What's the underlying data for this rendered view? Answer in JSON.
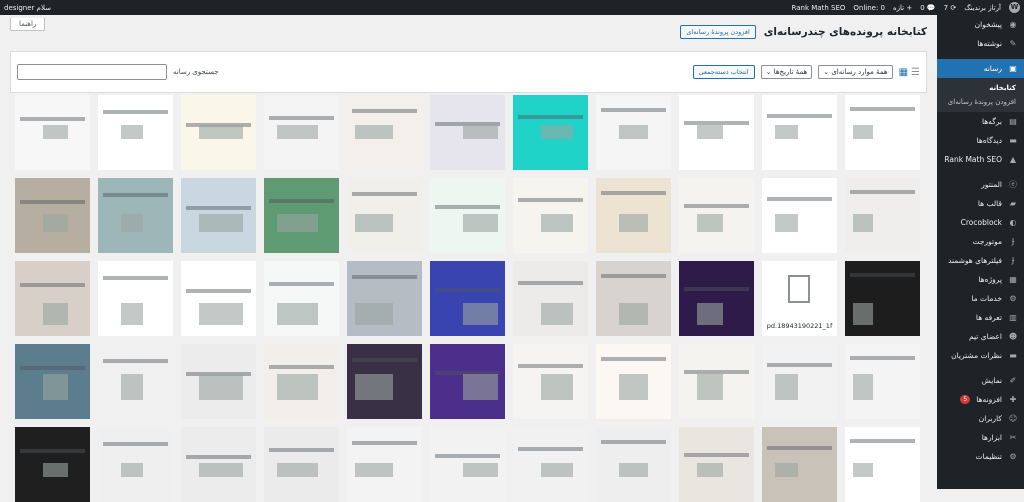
{
  "admin_bar": {
    "user_greeting": "سلام designer",
    "site_name": "آرتاز برندینگ",
    "updates_count": "7",
    "comments_count": "0",
    "new_label": "تازه",
    "rank_math_label": "Rank Math SEO",
    "online_label": "Online: 0"
  },
  "help_tab_label": "راهنما",
  "page": {
    "title": "کتابخانه پرونده‌های چندرسانه‌ای",
    "add_new_label": "افزودن پروندهٔ رسانه‌ای"
  },
  "toolbar": {
    "media_type_filter": "همهٔ موارد رسانه‌ای",
    "date_filter": "همهٔ تاریخ‌ها",
    "bulk_select_label": "انتخاب دسته‌جمعی",
    "search_label": "جستجوی رسانه",
    "search_value": ""
  },
  "sidebar": {
    "items": [
      {
        "label": "پیشخوان",
        "icon": "dashboard-icon"
      },
      {
        "label": "نوشته‌ها",
        "icon": "pin-icon"
      },
      {
        "label": "رسانه",
        "icon": "media-icon",
        "active": true
      },
      {
        "label": "برگه‌ها",
        "icon": "page-icon"
      },
      {
        "label": "دیدگاه‌ها",
        "icon": "comment-icon"
      },
      {
        "label": "Rank Math SEO",
        "icon": "rankmath-icon"
      },
      {
        "label": "المنتور",
        "icon": "elementor-icon"
      },
      {
        "label": "قالب ها",
        "icon": "folder-icon"
      },
      {
        "label": "Crocoblock",
        "icon": "crocoblock-icon"
      },
      {
        "label": "موتورجت",
        "icon": "jet-icon"
      },
      {
        "label": "فیلترهای هوشمند",
        "icon": "jet-icon"
      },
      {
        "label": "پروژه‌ها",
        "icon": "grid-icon"
      },
      {
        "label": "خدمات ما",
        "icon": "gear-icon"
      },
      {
        "label": "تعرفه ها",
        "icon": "price-icon"
      },
      {
        "label": "اعضای تیم",
        "icon": "team-icon"
      },
      {
        "label": "نظرات مشتریان",
        "icon": "comment-icon"
      },
      {
        "label": "نمایش",
        "icon": "brush-icon"
      },
      {
        "label": "افزونه‌ها",
        "icon": "plugin-icon",
        "badge": "5"
      },
      {
        "label": "کاربران",
        "icon": "user-icon"
      },
      {
        "label": "ابزارها",
        "icon": "wrench-icon"
      },
      {
        "label": "تنظیمات",
        "icon": "settings-icon"
      }
    ],
    "submenu": [
      "کتابخانه",
      "افزودن پروندهٔ رسانه‌ای"
    ]
  },
  "media": {
    "pdf_filename": "pd.18943190221_1f",
    "colors": {
      "row1": [
        "#ffffff",
        "#ffffff",
        "#ffffff",
        "#f5f5f5",
        "#20d3c8",
        "#e6e4ec",
        "#f3f0ec",
        "#f4f4f4",
        "#fbf6ea",
        "#ffffff",
        "#f7f7f7"
      ],
      "row2": [
        "#efeeec",
        "#ffffff",
        "#f4f3f0",
        "#ece3d3",
        "#f6f4ef",
        "#eef6f2",
        "#f0efea",
        "#5e9a72",
        "#c8d7e0",
        "#9db7b8",
        "#b6aea1"
      ],
      "row3": [
        "#1d1d1d",
        "#eaeaea",
        "#2e1b4a",
        "#d8d3ce",
        "#ecebea",
        "#3a44b0",
        "#b6bcc4",
        "#f6f8f8",
        "#ffffff",
        "#ffffff",
        "#d8d0c8"
      ],
      "row4": [
        "#f4f4f4",
        "#f2f2f2",
        "#f5f3f0",
        "#fbf8f3",
        "#f6f4f2",
        "#4b2f8a",
        "#3a3046",
        "#f2efea",
        "#ececec",
        "#f0f0f0",
        "#5b7d8d"
      ],
      "row5": [
        "#ffffff",
        "#c9c2b9",
        "#e9e5df",
        "#eeeeee",
        "#f1f1f1",
        "#f2f2f2",
        "#f3f3f3",
        "#ebebeb",
        "#ececec",
        "#efefef",
        "#1f1f1f"
      ]
    }
  }
}
